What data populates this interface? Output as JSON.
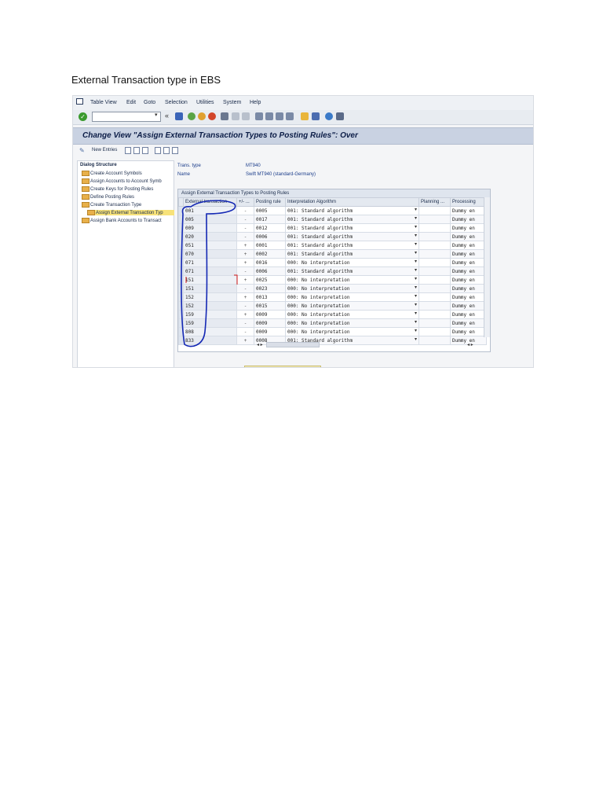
{
  "document": {
    "title": "External Transaction type in EBS"
  },
  "sap": {
    "menu": [
      "Table View",
      "Edit",
      "Goto",
      "Selection",
      "Utilities",
      "System",
      "Help"
    ],
    "toolbar": {
      "ok_icon": "check-icon",
      "command_value": "",
      "back_arrows": "«"
    },
    "screen_title": "Change View \"Assign External Transaction Types to Posting Rules\": Over",
    "app_toolbar": {
      "new_entries_label": "New Entries"
    },
    "dialog": {
      "heading": "Dialog Structure",
      "nodes": [
        "Create Account Symbols",
        "Assign Accounts to Account Symb",
        "Create Keys for Posting Rules",
        "Define Posting Rules",
        "Create Transaction Type",
        "Assign External Transaction Typ",
        "Assign Bank Accounts to Transact"
      ]
    },
    "header": {
      "trans_type_label": "Trans. type",
      "trans_type_value": "MT940",
      "name_label": "Name",
      "name_value": "Swift MT940 (standard-Germany)"
    },
    "grid": {
      "title": "Assign External Transaction Types to Posting Rules",
      "columns": [
        "External transaction",
        "+/- ...",
        "Posting rule",
        "Interpretation Algorithm",
        "Planning ...",
        "Processing"
      ],
      "rows": [
        [
          "001",
          "-",
          "0005",
          "001: Standard algorithm",
          "",
          "Dummy en"
        ],
        [
          "005",
          "-",
          "0017",
          "001: Standard algorithm",
          "",
          "Dummy en"
        ],
        [
          "009",
          "-",
          "0012",
          "001: Standard algorithm",
          "",
          "Dummy en"
        ],
        [
          "020",
          "-",
          "0006",
          "001: Standard algorithm",
          "",
          "Dummy en"
        ],
        [
          "051",
          "+",
          "0001",
          "001: Standard algorithm",
          "",
          "Dummy en"
        ],
        [
          "070",
          "+",
          "0002",
          "001: Standard algorithm",
          "",
          "Dummy en"
        ],
        [
          "071",
          "+",
          "0016",
          "000: No interpretation",
          "",
          "Dummy en"
        ],
        [
          "071",
          "-",
          "0006",
          "001: Standard algorithm",
          "",
          "Dummy en"
        ],
        [
          "151",
          "+",
          "0025",
          "000: No interpretation",
          "",
          "Dummy en"
        ],
        [
          "151",
          "-",
          "0023",
          "000: No interpretation",
          "",
          "Dummy en"
        ],
        [
          "152",
          "+",
          "0013",
          "000: No interpretation",
          "",
          "Dummy en"
        ],
        [
          "152",
          "-",
          "0015",
          "000: No interpretation",
          "",
          "Dummy en"
        ],
        [
          "159",
          "+",
          "0009",
          "000: No interpretation",
          "",
          "Dummy en"
        ],
        [
          "159",
          "-",
          "0009",
          "000: No interpretation",
          "",
          "Dummy en"
        ],
        [
          "808",
          "-",
          "0009",
          "000: No interpretation",
          "",
          "Dummy en"
        ],
        [
          "833",
          "+",
          "0008",
          "001: Standard algorithm",
          "",
          "Dummy en"
        ]
      ]
    },
    "colors": {
      "title_bar": "#c9d2e2",
      "title_text": "#0c1d47",
      "annotation": "#1428b4",
      "annotation_red": "#d21a1a"
    }
  }
}
